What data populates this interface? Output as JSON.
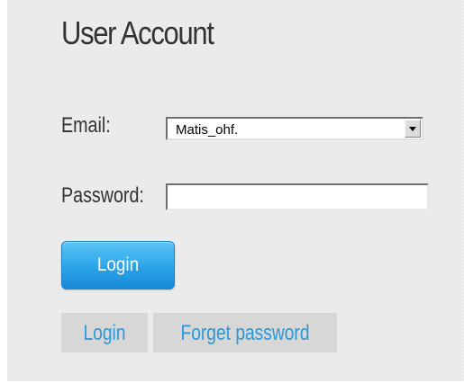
{
  "title": "User Account",
  "email": {
    "label": "Email:",
    "selected_value": "Matis_ohf."
  },
  "password": {
    "label": "Password:",
    "value": ""
  },
  "login_button": {
    "label": "Login"
  },
  "links": {
    "login": "Login",
    "forget_password": "Forget password"
  },
  "colors": {
    "background": "#ececec",
    "button": "#2ba3e8",
    "link_text": "#2c98d8",
    "link_background": "#d7d7d7"
  },
  "icons": {
    "select_arrow": "chevron-down-icon"
  }
}
